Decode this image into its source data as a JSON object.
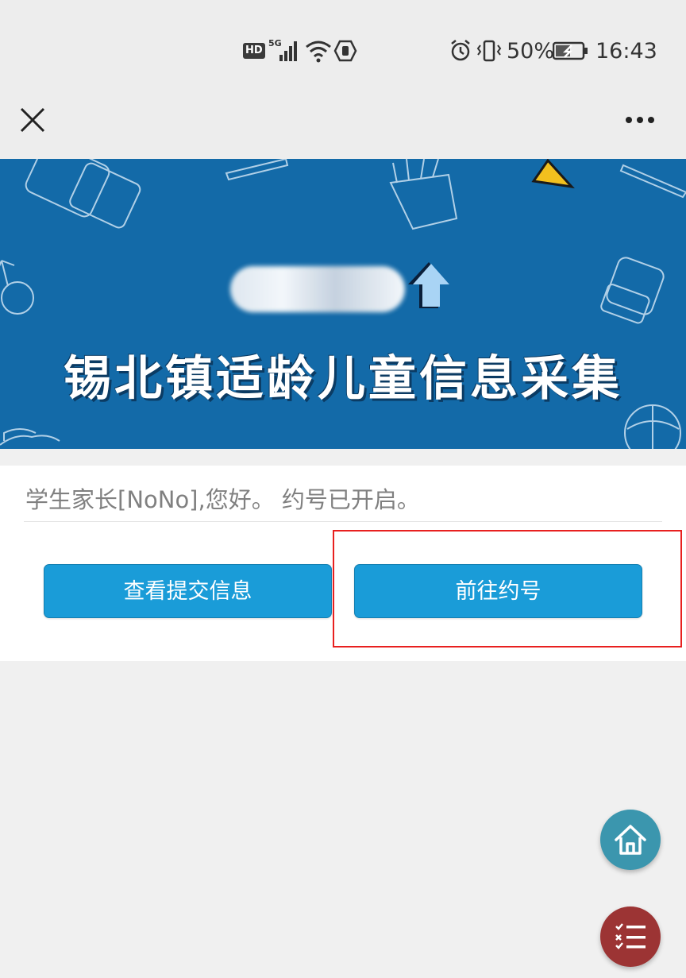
{
  "status_bar": {
    "network_badge": "HD",
    "network_type": "5G",
    "battery_percent": "50%",
    "time": "16:43",
    "icons": [
      "hd-icon",
      "signal-icon",
      "wifi-icon",
      "shield-icon",
      "alarm-icon",
      "vibrate-icon",
      "battery-charging-icon"
    ]
  },
  "nav": {
    "close_icon": "close-icon",
    "more_icon": "more-icon"
  },
  "banner": {
    "title": "锡北镇适龄儿童信息采集",
    "background_color": "#136aa8"
  },
  "content": {
    "greeting": "学生家长[NoNo],您好。 约号已开启。",
    "buttons": {
      "view_submission": "查看提交信息",
      "go_booking": "前往约号"
    },
    "button_color": "#1a9cd8",
    "highlight_color": "#e8201f"
  },
  "fabs": {
    "home_icon": "home-icon",
    "home_color": "#3b96ae",
    "list_icon": "checklist-icon",
    "list_color": "#9c3434"
  }
}
